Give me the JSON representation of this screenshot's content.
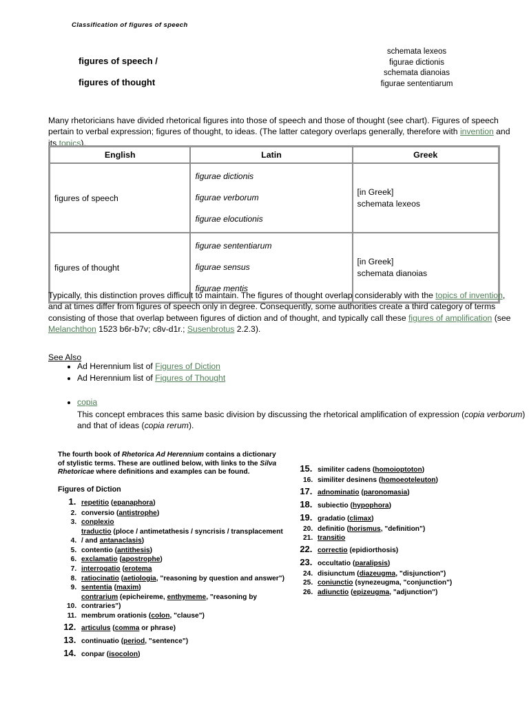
{
  "document": {
    "running_head": "Classification of figures of speech",
    "title_left": "figures of speech /\nfigures of thought",
    "title_right_lines": [
      "schemata lexeos",
      "figurae dictionis",
      "schemata dianoias",
      "figurae sententiarum"
    ]
  },
  "intro_paragraph": {
    "part1": "Many rhetoricians have divided rhetorical figures into those of speech and those of thought (see chart). Figures of speech pertain to verbal expression; figures of thought, to ideas. (The latter category overlaps generally, therefore with ",
    "link_invention": "invention",
    "part2": " and its ",
    "link_topics": "topics",
    "part3": ")."
  },
  "table": {
    "headers": [
      "English",
      "Latin",
      "Greek"
    ],
    "rows": [
      {
        "english": "figures of speech",
        "latin": [
          "figurae dictionis",
          "figurae verborum",
          "figurae elocutionis"
        ],
        "greek": [
          "[in Greek]",
          "schemata lexeos"
        ]
      },
      {
        "english": "figures of thought",
        "latin": [
          "figurae sententiarum",
          "figurae sensus",
          "figurae mentis"
        ],
        "greek": [
          "[in Greek]",
          "schemata dianoias"
        ]
      }
    ]
  },
  "mid_paragraph": {
    "part1": "Typically, this distinction proves difficult to maintain. The figures of thought overlap considerably with the ",
    "link_topics_of_invention": "topics of invention",
    "part2": ", and at times differ from figures of speech only in degree. Consequently, some authorities create a third category of terms consisting of those that overlap between figures of diction and of thought, and typically call these ",
    "link_figures_of_amplification": "figures of amplification",
    "part3": " (see ",
    "link_melanchthon": "Melanchthon",
    "part4": " 1523 b6r-b7v; c8v-d1r.; ",
    "link_susenbrotus": "Susenbrotus",
    "part5": " 2.2.3)."
  },
  "see_also": {
    "heading": "See Also",
    "items": [
      {
        "prefix": "Ad Herennium list of ",
        "link": "Figures of Diction"
      },
      {
        "prefix": "Ad Herennium list of ",
        "link": "Figures of Thought"
      }
    ],
    "copia": {
      "link": "copia",
      "body_part1": "This concept embraces this same basic division by discussing the rhetorical amplification of expression (",
      "italic1": "copia verborum",
      "body_part2": ") and that of ideas (",
      "italic2": "copia rerum",
      "body_part3": ")."
    }
  },
  "lower_block": {
    "blurb": {
      "part1": "The fourth book of ",
      "italic1": "Rhetorica Ad Herennium",
      "part2": " contains a dictionary of stylistic terms. These are outlined below, with links to the ",
      "italic2": "Silva Rhetoricae",
      "part3": " where definitions and examples can be found."
    },
    "section_heading": "Figures of Diction",
    "terms_left": [
      {
        "n": 1,
        "big": true,
        "html": "<a class='ul' href='#'>repetitio</a> (<a class='ul' href='#'>epanaphora</a>)"
      },
      {
        "n": 2,
        "big": false,
        "html": "conversio (<a class='ul' href='#'>antistrophe</a>)"
      },
      {
        "n": 3,
        "big": false,
        "html": "<a class='ul' href='#'>conplexio</a>"
      },
      {
        "n": 4,
        "big": false,
        "html": "<a class='ul' href='#'>traductio</a> (ploce / antimetathesis / syncrisis / transplacement / and <a class='ul' href='#'>antanaclasis</a>)"
      },
      {
        "n": 5,
        "big": false,
        "html": "contentio (<a class='ul' href='#'>antithesis</a>)"
      },
      {
        "n": 6,
        "big": false,
        "html": "<a class='ul' href='#'>exclamatio</a> (<a class='ul' href='#'>apostrophe</a>)"
      },
      {
        "n": 7,
        "big": false,
        "html": "<a class='ul' href='#'>interrogatio</a> (<a class='ul' href='#'>erotema</a>"
      },
      {
        "n": 8,
        "big": false,
        "html": "<a class='ul' href='#'>ratiocinatio</a> (<a class='ul' href='#'>aetiologia</a>, \"reasoning by question and answer\")"
      },
      {
        "n": 9,
        "big": false,
        "html": "<a class='ul' href='#'>sententia</a> (<a class='ul' href='#'>maxim</a>)"
      },
      {
        "n": 10,
        "big": false,
        "html": "<a class='ul' href='#'>contrarium</a> (epicheireme, <a class='ul' href='#'>enthymeme</a>, \"reasoning by contraries\")"
      },
      {
        "n": 11,
        "big": false,
        "html": "membrum orationis (<a class='ul' href='#'>colon</a>, \"clause\")"
      },
      {
        "n": 12,
        "big": true,
        "html": "<a class='ul' href='#'>articulus</a> (<a class='ul' href='#'>comma</a> or phrase)"
      },
      {
        "n": 13,
        "big": true,
        "html": "continuatio (<a class='ul' href='#'>period</a>, \"sentence\")"
      },
      {
        "n": 14,
        "big": true,
        "html": "conpar (<a class='ul' href='#'>isocolon</a>)"
      }
    ],
    "terms_right": [
      {
        "n": 15,
        "big": true,
        "html": "similiter cadens (<a class='ul' href='#'>homoioptoton</a>)"
      },
      {
        "n": 16,
        "big": false,
        "html": "similiter desinens (<a class='ul' href='#'>homoeoteleuton</a>)"
      },
      {
        "n": 17,
        "big": true,
        "html": "<a class='ul' href='#'>adnominatio</a> (<a class='ul' href='#'>paronomasia</a>)"
      },
      {
        "n": 18,
        "big": true,
        "html": "subiectio (<a class='ul' href='#'>hypophora</a>)"
      },
      {
        "n": 19,
        "big": true,
        "html": "gradatio (<a class='ul' href='#'>climax</a>)"
      },
      {
        "n": 20,
        "big": false,
        "html": "definitio (<a class='ul' href='#'>horismus</a>, \"definition\")"
      },
      {
        "n": 21,
        "big": false,
        "html": "<a class='ul' href='#'>transitio</a>"
      },
      {
        "n": 22,
        "big": true,
        "html": "<a class='ul' href='#'>correctio</a> (epidiorthosis)"
      },
      {
        "n": 23,
        "big": true,
        "html": "occultatio (<a class='ul' href='#'>paralipsis</a>)"
      },
      {
        "n": 24,
        "big": false,
        "html": "disiunctum (<a class='ul' href='#'>diazeugma</a>, \"disjunction\")"
      },
      {
        "n": 25,
        "big": false,
        "html": "<a class='ul' href='#'>coniunctio</a> (synezeugma, \"conjunction\")"
      },
      {
        "n": 26,
        "big": false,
        "html": "<a class='ul' href='#'>adiunctio</a> (<a class='ul' href='#'>epizeugma</a>, \"adjunction\")"
      }
    ]
  },
  "colors": {
    "link_green": "#4f7d56",
    "table_border": "#8c8c8c",
    "table_outer_border": "#9a9a9a",
    "text": "#000000",
    "background": "#ffffff"
  }
}
